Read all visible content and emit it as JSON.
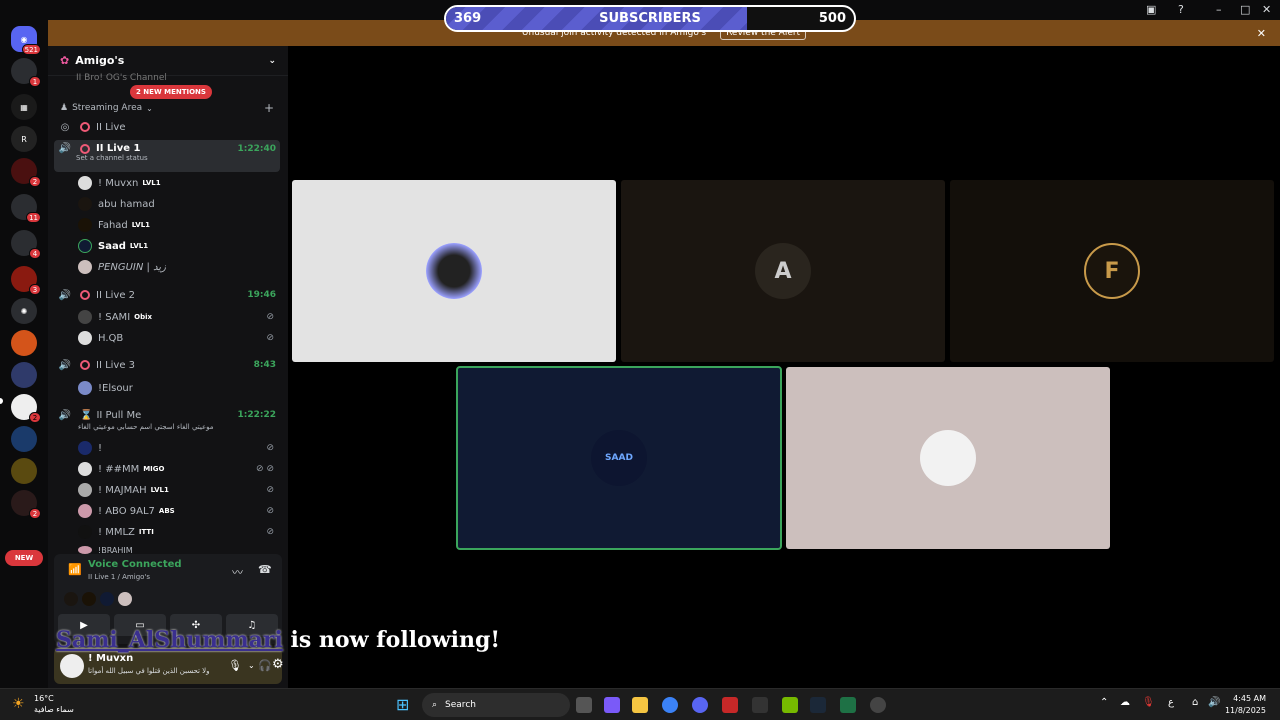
{
  "subscriber_goal": {
    "current": "369",
    "label": "SUBSCRIBERS",
    "goal": "500",
    "progress": 0.738
  },
  "alert": {
    "text": "Unusual join activity detected in Amigo's",
    "action": "Review the Alert"
  },
  "server": {
    "name": "Amigo's",
    "mentions": "2 NEW MENTIONS",
    "rail_badges": [
      "521",
      "1",
      "2",
      "11",
      "4",
      "3",
      "2",
      "2"
    ],
    "new_label": "NEW"
  },
  "channels": {
    "partial_top": "II Bro! OG's Channel",
    "category": "Streaming Area",
    "live": "II Live",
    "live1": {
      "name": "II Live 1",
      "time": "1:22:40",
      "status": "Set a channel status"
    },
    "live1_users": [
      {
        "name": "! Muvxn",
        "tag": "LVL1"
      },
      {
        "name": "abu hamad",
        "tag": ""
      },
      {
        "name": "Fahad",
        "tag": "LVL1"
      },
      {
        "name": "Saad",
        "tag": "LVL1"
      },
      {
        "name": "PENGUIN | زيد",
        "tag": ""
      }
    ],
    "live2": {
      "name": "II Live 2",
      "time": "19:46"
    },
    "live2_users": [
      {
        "name": "! SAMI",
        "tag": "Obix"
      },
      {
        "name": "H.QB",
        "tag": ""
      }
    ],
    "live3": {
      "name": "II Live 3",
      "time": "8:43"
    },
    "live3_users": [
      {
        "name": "!Elsour",
        "tag": ""
      }
    ],
    "pullme": {
      "name": "II Pull Me",
      "time": "1:22:22",
      "status": "موعيتي الغاء اسجتي اسم حسابي موعيتي الغاء"
    },
    "pullme_users": [
      {
        "name": "!",
        "tag": ""
      },
      {
        "name": "! ##MM",
        "tag": "MIGO"
      },
      {
        "name": "! MAJMAH",
        "tag": "LVL1"
      },
      {
        "name": "! ABO 9AL7",
        "tag": "ABS"
      },
      {
        "name": "! MMLZ",
        "tag": "ITTI"
      },
      {
        "name": "!BRAHIM",
        "tag": ""
      }
    ]
  },
  "voice": {
    "title": "Voice Connected",
    "sub": "II Live 1 / Amigo's"
  },
  "user": {
    "name": "! Muvxn",
    "status": "ولا تحسبن الذين قتلوا في سبيل الله أمواتا"
  },
  "tiles": [
    {
      "label": "",
      "color": "#e3e3e3"
    },
    {
      "label": "A",
      "color": "#1a1510"
    },
    {
      "label": "F",
      "color": "#130f0a"
    },
    {
      "label": "SAAD",
      "color": "#101a33"
    },
    {
      "label": "",
      "color": "#ccbfbd"
    }
  ],
  "follow": {
    "who": "Sami_AlShummari",
    "text": "is now following!"
  },
  "taskbar": {
    "weather_temp": "16°C",
    "weather_desc": "سماء صافية",
    "search": "Search",
    "time": "4:45 AM",
    "date": "11/8/2025",
    "lang": "ع"
  }
}
